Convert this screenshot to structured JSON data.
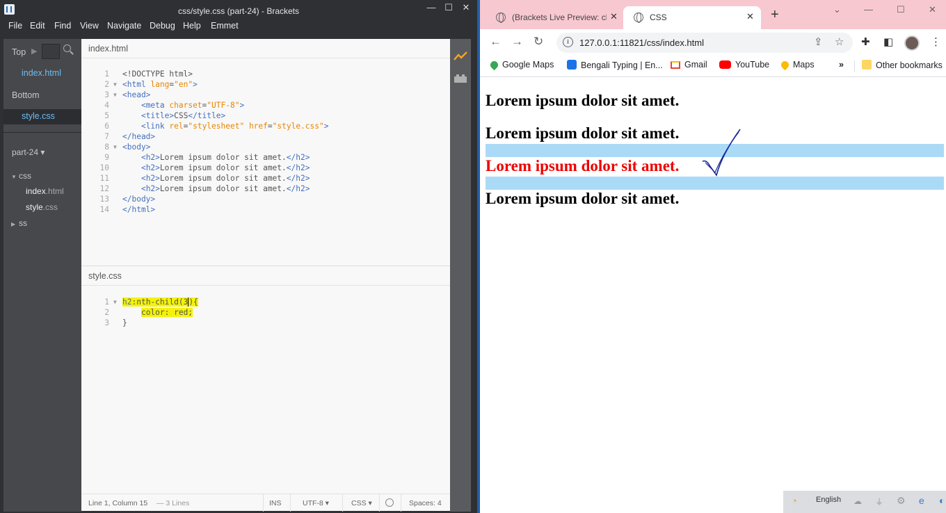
{
  "brackets": {
    "title": "css/style.css (part-24) - Brackets",
    "menu": [
      "File",
      "Edit",
      "Find",
      "View",
      "Navigate",
      "Debug",
      "Help",
      "Emmet"
    ],
    "sidebar": {
      "top_label": "Top",
      "top_file": "index.html",
      "bottom_label": "Bottom",
      "bottom_file": "style.css",
      "project": "part-24 ▾",
      "folder_css": "css",
      "file_index_name": "index",
      "file_index_ext": ".html",
      "file_style_name": "style",
      "file_style_ext": ".css",
      "folder_ss": "ss"
    },
    "top_editor": {
      "filename": "index.html",
      "line_numbers": [
        "1",
        "2",
        "3",
        "4",
        "5",
        "6",
        "7",
        "8",
        "9",
        "10",
        "11",
        "12",
        "13",
        "14"
      ]
    },
    "bottom_editor": {
      "filename": "style.css",
      "line_numbers": [
        "1",
        "2",
        "3"
      ]
    },
    "status": {
      "position": "Line 1, Column 15",
      "lines": "— 3 Lines",
      "mode": "INS",
      "encoding": "UTF-8 ▾",
      "language": "CSS ▾",
      "spaces": "Spaces:  4"
    }
  },
  "chrome": {
    "tabs": [
      {
        "title": "(Brackets Live Preview: cl"
      },
      {
        "title": "CSS"
      }
    ],
    "url": "127.0.0.1:11821/css/index.html",
    "bookmarks": [
      "Google Maps",
      "Bengali Typing | En...",
      "Gmail",
      "YouTube",
      "Maps",
      "»",
      "Other bookmarks"
    ],
    "headings": [
      "Lorem ipsum dolor sit amet.",
      "Lorem ipsum dolor sit amet.",
      "Lorem ipsum dolor sit amet.",
      "Lorem ipsum dolor sit amet."
    ],
    "highlight_color": "#abdaf6",
    "nth_child_color": "#ee0000"
  },
  "taskbar": {
    "language": "English"
  }
}
